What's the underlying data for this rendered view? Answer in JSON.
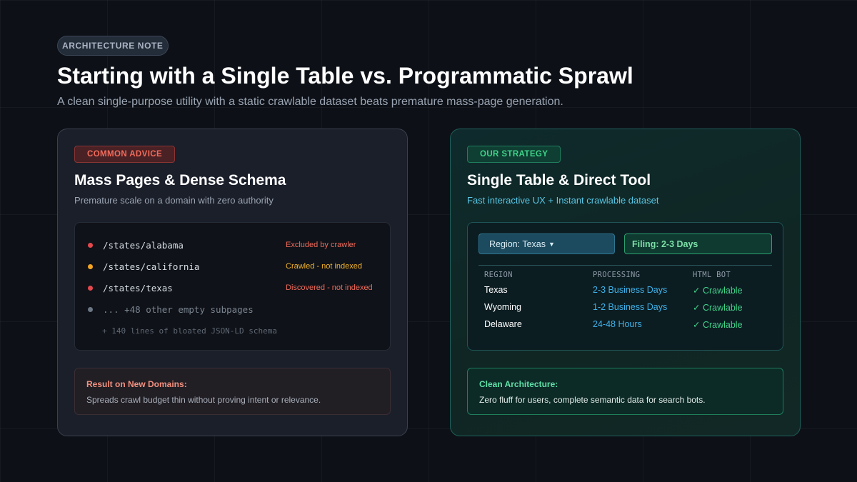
{
  "header": {
    "badge": "ARCHITECTURE NOTE",
    "title": "Starting with a Single Table vs. Programmatic Sprawl",
    "subtitle": "A clean single-purpose utility with a static crawlable dataset beats premature mass-page generation."
  },
  "left_card": {
    "pill": "COMMON ADVICE",
    "title": "Mass Pages & Dense Schema",
    "description": "Premature scale on a domain with zero authority",
    "rows": [
      {
        "path": "/states/alabama",
        "status": "Excluded by crawler",
        "dot_color": "#e5484d",
        "status_color": "#f26b5b"
      },
      {
        "path": "/states/california",
        "status": "Crawled - not indexed",
        "dot_color": "#f5a524",
        "status_color": "#f5b52a"
      },
      {
        "path": "/states/texas",
        "status": "Discovered - not indexed",
        "dot_color": "#e5484d",
        "status_color": "#f26b5b"
      },
      {
        "path": "... +48 other empty subpages",
        "status": "",
        "dot_color": "#6b7785",
        "status_color": "#6b7785"
      }
    ],
    "schema_note": "+ 140 lines of bloated JSON-LD schema",
    "result": {
      "title": "Result on New Domains:",
      "text": "Spreads crawl budget thin without proving intent or relevance."
    }
  },
  "right_card": {
    "pill": "OUR STRATEGY",
    "title": "Single Table & Direct Tool",
    "description": "Fast interactive UX + Instant crawlable dataset",
    "region_select": "Region: Texas",
    "filing_badge": "Filing: 2-3 Days",
    "table": {
      "headers": [
        "REGION",
        "PROCESSING",
        "HTML BOT"
      ],
      "rows": [
        [
          "Texas",
          "2-3 Business Days",
          "✓ Crawlable"
        ],
        [
          "Wyoming",
          "1-2 Business Days",
          "✓ Crawlable"
        ],
        [
          "Delaware",
          "24-48 Hours",
          "✓ Crawlable"
        ]
      ]
    },
    "architecture": {
      "title": "Clean Architecture:",
      "text": "Zero fluff for users, complete semantic data for search bots."
    }
  }
}
